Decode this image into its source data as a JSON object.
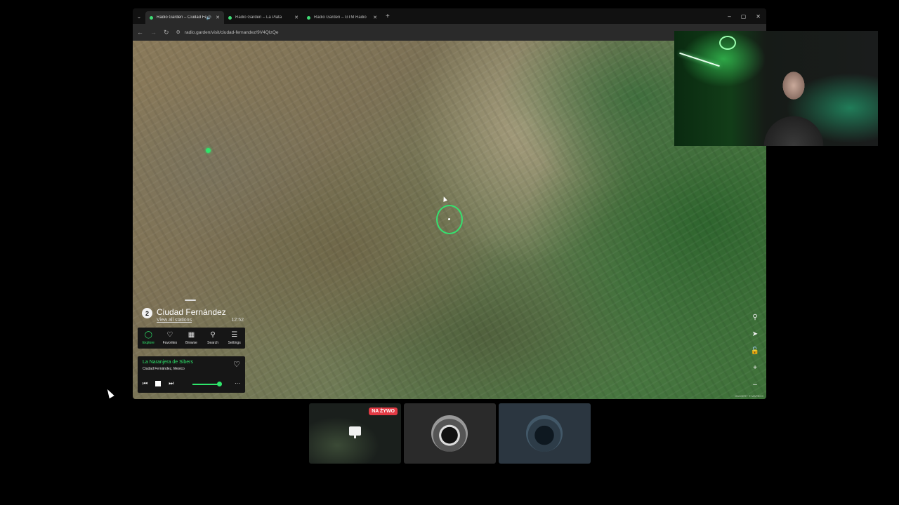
{
  "browser": {
    "tabs": [
      {
        "label": "Radio Garden – Ciudad Fer",
        "active": true,
        "audio": true
      },
      {
        "label": "Radio Garden – La Plata",
        "active": false
      },
      {
        "label": "Radio Garden – GTM Radio",
        "active": false
      }
    ],
    "new_tab": "+",
    "url": "radio.garden/visit/ciudad-fernandez/9V4QIzQe",
    "window_controls": {
      "minimize": "–",
      "maximize": "▢",
      "close": "✕"
    }
  },
  "map": {
    "credit": "IMAGERY © MAPBOX",
    "controls": [
      "marker-icon",
      "locate-icon",
      "lock-icon",
      "zoom-in-icon",
      "zoom-out-icon"
    ],
    "zoom_in": "+",
    "zoom_out": "–"
  },
  "location": {
    "count": "2",
    "name": "Ciudad Fernández",
    "subtitle": "View all stations",
    "time": "12:52"
  },
  "nav": [
    {
      "label": "Explore",
      "icon": "explore-icon",
      "glyph": "◯",
      "active": true
    },
    {
      "label": "Favorites",
      "icon": "heart-icon",
      "glyph": "♡",
      "active": false
    },
    {
      "label": "Browse",
      "icon": "map-icon",
      "glyph": "▦",
      "active": false
    },
    {
      "label": "Search",
      "icon": "search-icon",
      "glyph": "⚲",
      "active": false
    },
    {
      "label": "Settings",
      "icon": "settings-icon",
      "glyph": "☰",
      "active": false
    }
  ],
  "player": {
    "station": "La Naranjera de Sibers",
    "place": "Ciudad Fernández, Mexico",
    "volume": 0.9,
    "more": "···"
  },
  "thumbnails": {
    "live_badge": "NA ŻYWO"
  },
  "colors": {
    "accent": "#2ee56b",
    "live": "#e23a44"
  }
}
